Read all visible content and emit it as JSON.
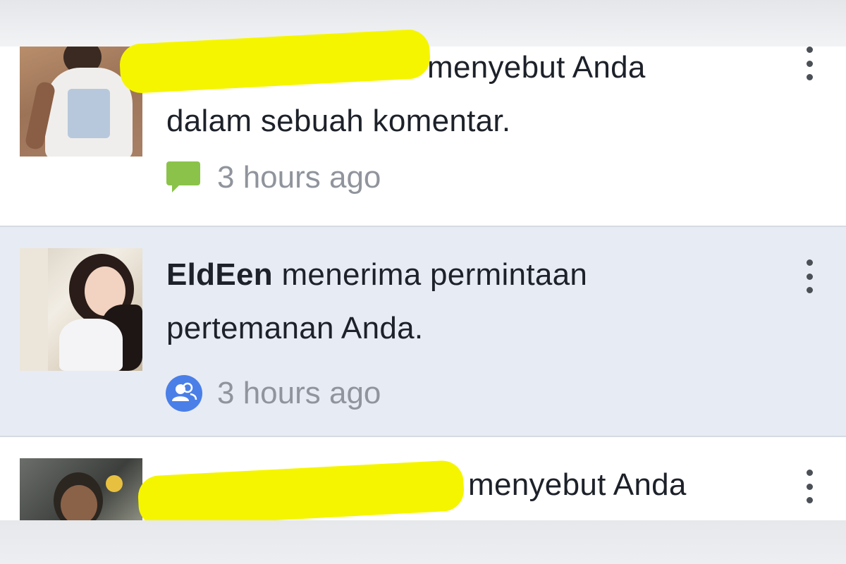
{
  "notifications": [
    {
      "state": "read",
      "actor_name": "",
      "message": "menyebut Anda dalam sebuah komentar.",
      "message_line1_tail": "menyebut Anda",
      "message_line2": "dalam sebuah komentar.",
      "time": "3 hours ago",
      "type_icon": "comment-icon",
      "type_icon_color": "#8bc34a",
      "name_redacted": true
    },
    {
      "state": "unread",
      "actor_name": "EldEen",
      "message_line1_tail": "menerima permintaan",
      "message_line2": "pertemanan Anda.",
      "time": "3 hours ago",
      "type_icon": "friends-icon",
      "type_icon_color": "#4a7fe8",
      "name_redacted": false
    },
    {
      "state": "read",
      "actor_name": "",
      "message_line1_tail": "menyebut Anda",
      "name_redacted": true
    }
  ],
  "colors": {
    "unread_background": "#e7ebf3",
    "read_background": "#ffffff",
    "redaction_marker": "#f6f500",
    "text": "#1d2129",
    "meta_text": "#90949c"
  }
}
